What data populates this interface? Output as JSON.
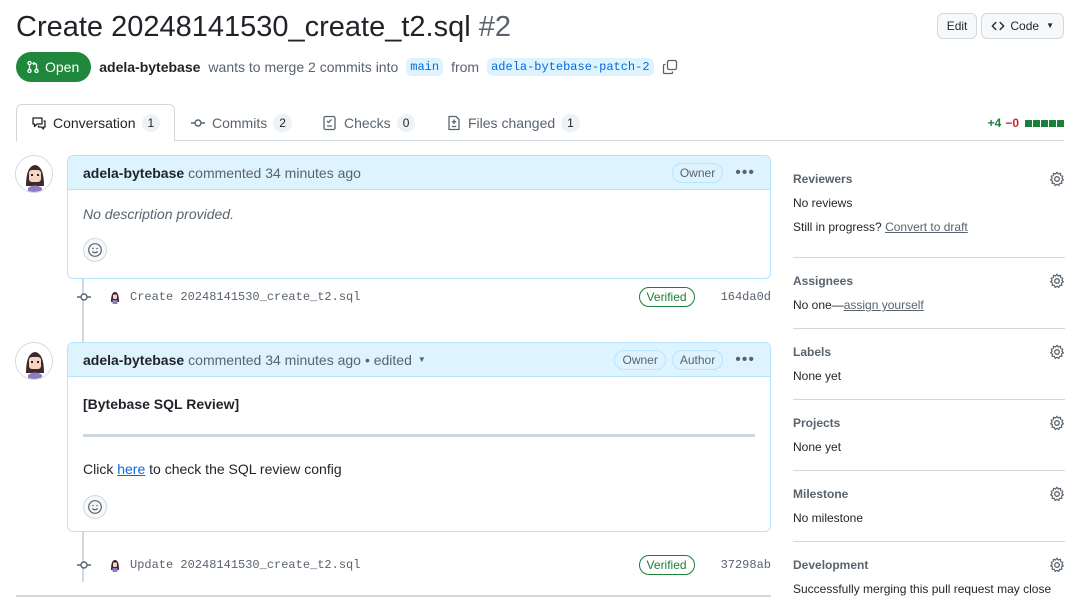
{
  "header": {
    "title": "Create 20248141530_create_t2.sql",
    "number": "#2",
    "edit_label": "Edit",
    "code_label": "Code"
  },
  "state": {
    "badge": "Open",
    "author": "adela-bytebase",
    "text_mid": "wants to merge 2 commits into",
    "base_branch": "main",
    "text_from": "from",
    "head_branch": "adela-bytebase-patch-2"
  },
  "tabs": [
    {
      "label": "Conversation",
      "count": "1"
    },
    {
      "label": "Commits",
      "count": "2"
    },
    {
      "label": "Checks",
      "count": "0"
    },
    {
      "label": "Files changed",
      "count": "1"
    }
  ],
  "diffstat": {
    "additions": "+4",
    "deletions": "−0"
  },
  "comments": [
    {
      "author": "adela-bytebase",
      "meta": "commented 34 minutes ago",
      "edited": "",
      "roles": [
        "Owner"
      ],
      "body": "No description provided."
    },
    {
      "author": "adela-bytebase",
      "meta": "commented 34 minutes ago",
      "edited": "• edited",
      "roles": [
        "Owner",
        "Author"
      ],
      "heading": "[Bytebase SQL Review]",
      "body_prefix": "Click",
      "body_link": "here",
      "body_suffix": "to check the SQL review config"
    }
  ],
  "commits": [
    {
      "message": "Create 20248141530_create_t2.sql",
      "status": "Verified",
      "sha": "164da0d"
    },
    {
      "message": "Update 20248141530_create_t2.sql",
      "status": "Verified",
      "sha": "37298ab"
    }
  ],
  "sidebar": {
    "reviewers": {
      "title": "Reviewers",
      "value": "No reviews",
      "progress_text": "Still in progress?",
      "progress_link": "Convert to draft"
    },
    "assignees": {
      "title": "Assignees",
      "value": "No one—",
      "link": "assign yourself"
    },
    "labels": {
      "title": "Labels",
      "value": "None yet"
    },
    "projects": {
      "title": "Projects",
      "value": "None yet"
    },
    "milestone": {
      "title": "Milestone",
      "value": "No milestone"
    },
    "development": {
      "title": "Development",
      "value": "Successfully merging this pull request may close"
    }
  },
  "colors": {
    "open_green": "#1f883d",
    "link_blue": "#0969da",
    "comment_header_bg": "#ddf4ff"
  }
}
